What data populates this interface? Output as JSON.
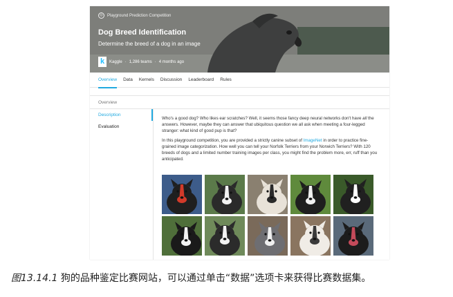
{
  "hero": {
    "badge": "Playground Prediction Competition",
    "title": "Dog Breed Identification",
    "subtitle": "Determine the breed of a dog in an image",
    "logo_letter": "k",
    "host": "Kaggle",
    "teams": "1,286 teams",
    "age": "4 months ago"
  },
  "tabs": [
    {
      "label": "Overview",
      "active": true
    },
    {
      "label": "Data",
      "active": false
    },
    {
      "label": "Kernels",
      "active": false
    },
    {
      "label": "Discussion",
      "active": false
    },
    {
      "label": "Leaderboard",
      "active": false
    },
    {
      "label": "Rules",
      "active": false
    }
  ],
  "panel": {
    "heading": "Overview",
    "sidebar": [
      {
        "label": "Description",
        "active": true
      },
      {
        "label": "Evaluation",
        "active": false
      }
    ],
    "para1_a": "Who's a good dog? Who likes ear scratches? Well, it seems those fancy deep neural networks don't have ",
    "para1_em": "all",
    "para1_b": " the answers. However, maybe they can answer that ubiquitous question we all ask when meeting a four-legged stranger: what kind of good pup is that?",
    "para2_a": "In this playground competition, you are provided a strictly canine subset of ",
    "para2_link": "ImageNet",
    "para2_b": " in order to practice fine-grained image categorization. How well you can tell your Norfolk Terriers from your Norwich Terriers? With 120 breeds of dogs and a limited number training images per class, you might find the problem more, err, ruff than you anticipated."
  },
  "dogs": [
    {
      "name": "dog-photo-1",
      "bg": "#3d5c8a",
      "fur": "#1f1f1f",
      "accent": "#d23a2a"
    },
    {
      "name": "dog-photo-2",
      "bg": "#5b7a4a",
      "fur": "#2a2a2a",
      "accent": "#f2f2f2"
    },
    {
      "name": "dog-photo-3",
      "bg": "#8a8070",
      "fur": "#e8e2d8",
      "accent": "#2a2a2a"
    },
    {
      "name": "dog-photo-4",
      "bg": "#5f8a3c",
      "fur": "#1e1e1e",
      "accent": "#f0f0f0"
    },
    {
      "name": "dog-photo-5",
      "bg": "#3a5a2a",
      "fur": "#202020",
      "accent": "#ffffff"
    },
    {
      "name": "dog-photo-6",
      "bg": "#4f6f3a",
      "fur": "#1a1a1a",
      "accent": "#f4f4f4"
    },
    {
      "name": "dog-photo-7",
      "bg": "#6f8a5a",
      "fur": "#2b2b2b",
      "accent": "#f3f3f3"
    },
    {
      "name": "dog-photo-8",
      "bg": "#7a6a5a",
      "fur": "#6e6e72",
      "accent": "#efefef"
    },
    {
      "name": "dog-photo-9",
      "bg": "#8a7560",
      "fur": "#f0ece6",
      "accent": "#3a3a3a"
    },
    {
      "name": "dog-photo-10",
      "bg": "#5a6a7a",
      "fur": "#1c1c1c",
      "accent": "#c44a5a"
    }
  ],
  "caption": {
    "figure": "图13.14.1",
    "text": " 狗的品种鉴定比赛网站，可以通过单击“数据”选项卡来获得比赛数据集。"
  }
}
